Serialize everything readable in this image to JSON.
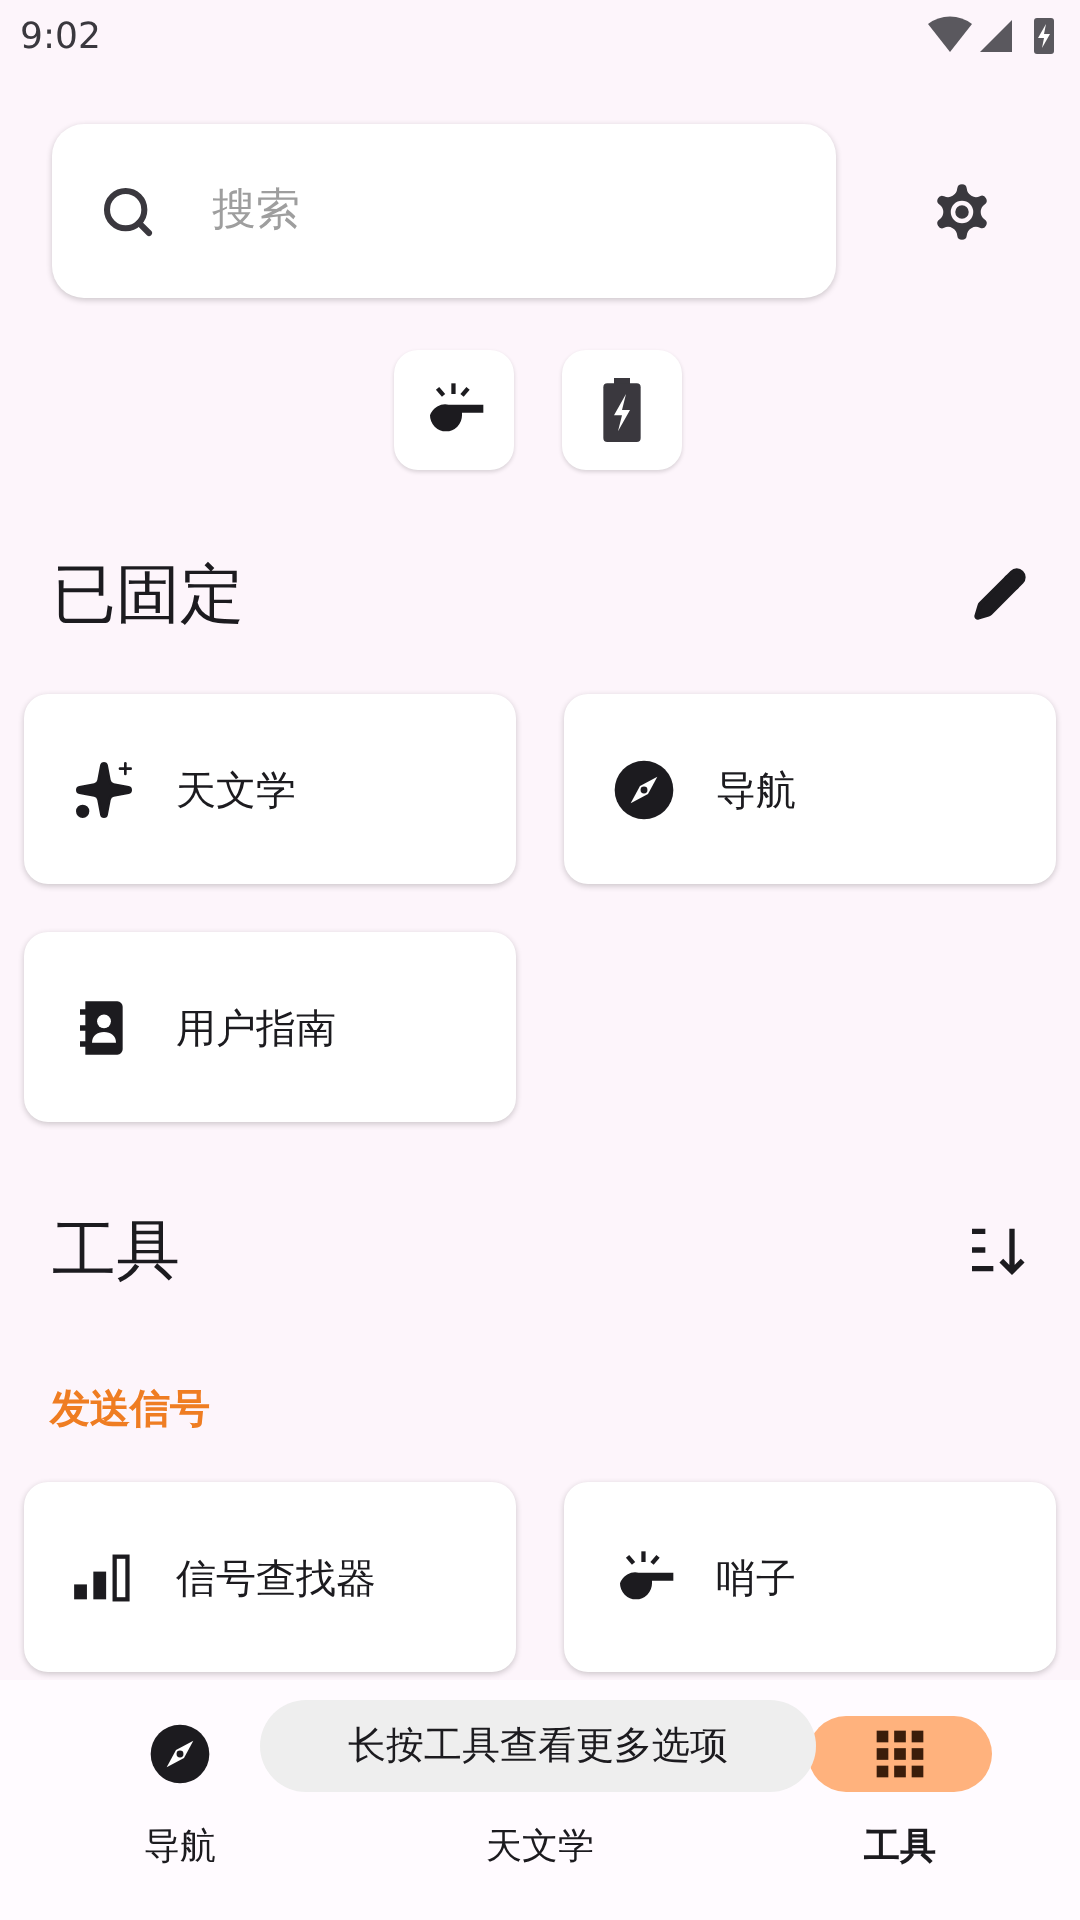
{
  "status_bar": {
    "time": "9:02"
  },
  "search": {
    "placeholder": "搜索"
  },
  "quick_actions": [
    {
      "kind": "whistle"
    },
    {
      "kind": "battery"
    }
  ],
  "pinned": {
    "title": "已固定",
    "items": [
      {
        "kind": "astronomy",
        "label": "天文学"
      },
      {
        "kind": "navigation",
        "label": "导航"
      },
      {
        "kind": "guide",
        "label": "用户指南"
      }
    ]
  },
  "tools": {
    "title": "工具",
    "sections": [
      {
        "title": "发送信号",
        "items": [
          {
            "kind": "signal",
            "label": "信号查找器"
          },
          {
            "kind": "whistle",
            "label": "哨子"
          }
        ]
      }
    ]
  },
  "bottom_nav": [
    {
      "kind": "navigation",
      "label": "导航",
      "selected": false
    },
    {
      "kind": "astronomy",
      "label": "天文学",
      "selected": false
    },
    {
      "kind": "tools",
      "label": "工具",
      "selected": true
    }
  ],
  "toast": "长按工具查看更多选项"
}
